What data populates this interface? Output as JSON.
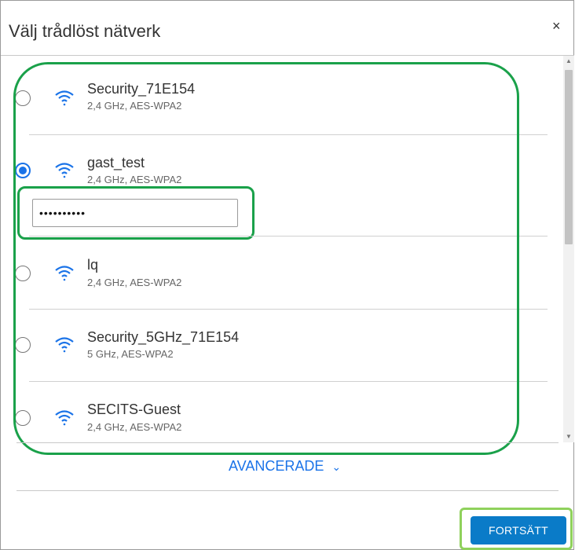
{
  "dialog": {
    "title": "Välj trådlöst nätverk",
    "close_label": "×"
  },
  "networks": [
    {
      "ssid": "Security_71E154",
      "detail": "2,4 GHz, AES-WPA2",
      "selected": false
    },
    {
      "ssid": "gast_test",
      "detail": "2,4 GHz, AES-WPA2",
      "selected": true,
      "password_value": "••••••••••"
    },
    {
      "ssid": "lq",
      "detail": "2,4 GHz, AES-WPA2",
      "selected": false
    },
    {
      "ssid": "Security_5GHz_71E154",
      "detail": "5 GHz, AES-WPA2",
      "selected": false
    },
    {
      "ssid": "SECITS-Guest",
      "detail": "2,4 GHz, AES-WPA2",
      "selected": false
    }
  ],
  "advanced": {
    "label": "AVANCERADE",
    "chevron": "⌄"
  },
  "footer": {
    "continue_label": "FORTSÄTT"
  },
  "colors": {
    "accent": "#1a73e8",
    "button": "#0a7bc8",
    "highlight": "#1aa14a",
    "highlight_light": "#8fd15c"
  },
  "icons": {
    "wifi": "wifi-icon",
    "close": "close-icon",
    "chevron": "chevron-down-icon"
  }
}
